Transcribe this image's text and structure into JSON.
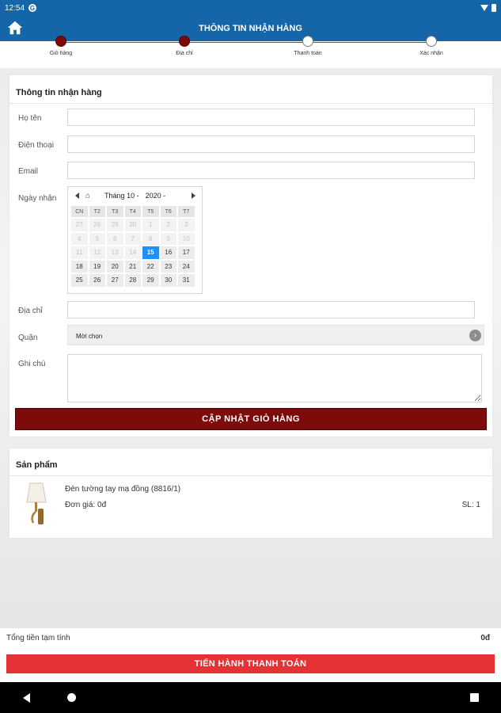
{
  "status_bar": {
    "time": "12:54",
    "notification_icon": "g-icon"
  },
  "header": {
    "title": "THÔNG TIN NHẬN HÀNG",
    "home_icon": "home-icon"
  },
  "stepper": {
    "steps": [
      {
        "label": "Giỏ hàng",
        "active": true
      },
      {
        "label": "Địa chỉ",
        "active": true
      },
      {
        "label": "Thanh toán",
        "active": false
      },
      {
        "label": "Xác nhận",
        "active": false
      }
    ]
  },
  "form": {
    "title": "Thông tin nhận hàng",
    "name_label": "Họ tên",
    "phone_label": "Điện thoại",
    "email_label": "Email",
    "date_label": "Ngày nhận",
    "address_label": "Địa chỉ",
    "district_label": "Quận",
    "district_value": "Mời chọn",
    "note_label": "Ghi chú",
    "update_button": "CẬP NHẬT GIỎ HÀNG"
  },
  "calendar": {
    "month": "Tháng 10 -",
    "year": "2020 -",
    "weekdays": [
      "CN",
      "T2",
      "T3",
      "T4",
      "T5",
      "T6",
      "T7"
    ],
    "days": [
      {
        "d": "27",
        "muted": true
      },
      {
        "d": "28",
        "muted": true
      },
      {
        "d": "29",
        "muted": true
      },
      {
        "d": "30",
        "muted": true
      },
      {
        "d": "1",
        "muted": true
      },
      {
        "d": "2",
        "muted": true
      },
      {
        "d": "3",
        "muted": true
      },
      {
        "d": "4",
        "muted": true
      },
      {
        "d": "5",
        "muted": true
      },
      {
        "d": "6",
        "muted": true
      },
      {
        "d": "7",
        "muted": true
      },
      {
        "d": "8",
        "muted": true
      },
      {
        "d": "9",
        "muted": true
      },
      {
        "d": "10",
        "muted": true
      },
      {
        "d": "11",
        "muted": true
      },
      {
        "d": "12",
        "muted": true
      },
      {
        "d": "13",
        "muted": true
      },
      {
        "d": "14",
        "muted": true
      },
      {
        "d": "15",
        "selected": true
      },
      {
        "d": "16"
      },
      {
        "d": "17"
      },
      {
        "d": "18"
      },
      {
        "d": "19"
      },
      {
        "d": "20"
      },
      {
        "d": "21"
      },
      {
        "d": "22"
      },
      {
        "d": "23"
      },
      {
        "d": "24"
      },
      {
        "d": "25"
      },
      {
        "d": "26"
      },
      {
        "d": "27"
      },
      {
        "d": "28"
      },
      {
        "d": "29"
      },
      {
        "d": "30"
      },
      {
        "d": "31"
      }
    ]
  },
  "products": {
    "title": "Sản phẩm",
    "items": [
      {
        "name": "Đèn tường tay mạ đồng (8816/1)",
        "price_label": "Đơn giá: 0đ",
        "qty": "SL: 1"
      }
    ]
  },
  "footer": {
    "total_label": "Tổng tiền tạm tính",
    "total_value": "0đ",
    "checkout_button": "TIẾN HÀNH THANH TOÁN"
  },
  "colors": {
    "header_blue": "#1565a9",
    "step_active": "#7a0a0a",
    "update_button": "#7d0b0b",
    "checkout_button": "#e53236",
    "calendar_selected": "#1e90ff"
  }
}
